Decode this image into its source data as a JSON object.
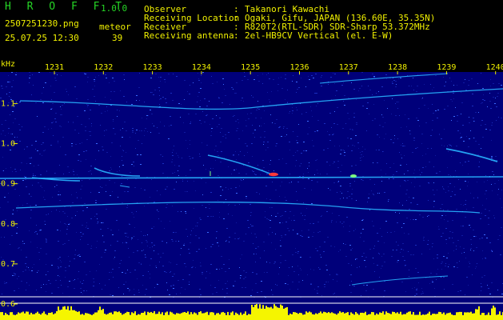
{
  "app": {
    "name": "H R O F F T",
    "version": "1.0.0"
  },
  "file": {
    "name": "2507251230.png",
    "datetime": "25.07.25 12:30"
  },
  "meteor": {
    "label": "meteor",
    "count": "39"
  },
  "info": [
    {
      "label": "Observer",
      "sep": ":",
      "value": "Takanori Kawachi"
    },
    {
      "label": "Receiving Location",
      "sep": ":",
      "value": "Ogaki, Gifu, JAPAN (136.60E, 35.35N)"
    },
    {
      "label": "Receiver",
      "sep": ":",
      "value": "R820T2(RTL-SDR) SDR-Sharp 53.372MHz"
    },
    {
      "label": "Receiving antenna",
      "sep": ":",
      "value": "2el-HB9CV Vertical (el. E-W)"
    }
  ],
  "chart_data": {
    "type": "heatmap",
    "ylabel": "kHz",
    "x_ticks": [
      "1231",
      "1232",
      "1233",
      "1234",
      "1235",
      "1236",
      "1237",
      "1238",
      "1239",
      "1240"
    ],
    "y_ticks": [
      "1.1",
      "1.0",
      "0.9",
      "0.8",
      "0.7",
      "0.6"
    ],
    "colors": {
      "background": "#00007a",
      "trace": "#28b4ff",
      "hot": "#ff3a3a",
      "power": "#f5f500",
      "text_green": "#26d626",
      "text_yellow": "#f0f000"
    }
  }
}
